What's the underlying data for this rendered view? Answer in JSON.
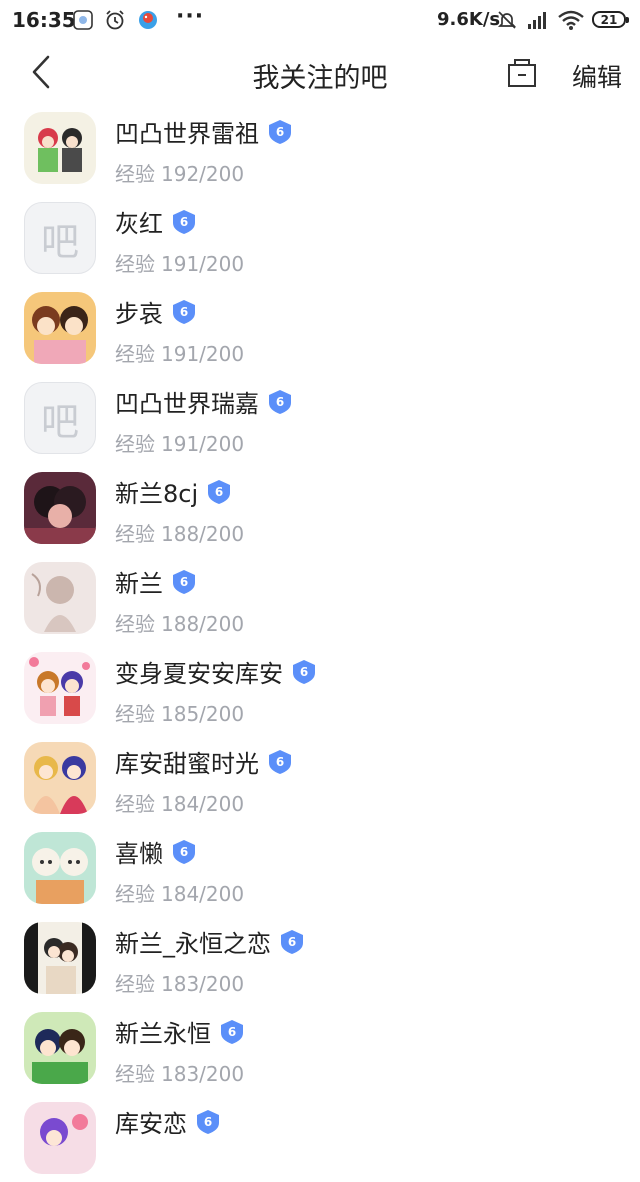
{
  "status_bar": {
    "time": "16:35",
    "network_speed": "9.6K/s",
    "battery": "21",
    "icons": [
      "notification-app-icon",
      "alarm-icon",
      "bird-app-icon",
      "more-dots-icon",
      "mute-bell-icon",
      "signal-icon",
      "wifi-icon",
      "battery-icon"
    ],
    "dots": "···"
  },
  "nav": {
    "title": "我关注的吧",
    "edit_label": "编辑",
    "back_icon": "chevron-left-icon",
    "folder_icon": "folder-icon"
  },
  "colors": {
    "level_badge": "#5b8ff9",
    "exp_text": "#a3a6ad"
  },
  "bars": [
    {
      "name": "凹凸世界雷祖",
      "level": "6",
      "exp_label": "经验",
      "exp": "192/200",
      "avatar": "cartoon-image"
    },
    {
      "name": "灰红",
      "level": "6",
      "exp_label": "经验",
      "exp": "191/200",
      "avatar": "placeholder",
      "placeholder_char": "吧"
    },
    {
      "name": "步哀",
      "level": "6",
      "exp_label": "经验",
      "exp": "191/200",
      "avatar": "cartoon-image"
    },
    {
      "name": "凹凸世界瑞嘉",
      "level": "6",
      "exp_label": "经验",
      "exp": "191/200",
      "avatar": "placeholder",
      "placeholder_char": "吧"
    },
    {
      "name": "新兰8cj",
      "level": "6",
      "exp_label": "经验",
      "exp": "188/200",
      "avatar": "cartoon-image"
    },
    {
      "name": "新兰",
      "level": "6",
      "exp_label": "经验",
      "exp": "188/200",
      "avatar": "cartoon-image"
    },
    {
      "name": "变身夏安安库安",
      "level": "6",
      "exp_label": "经验",
      "exp": "185/200",
      "avatar": "cartoon-image"
    },
    {
      "name": "库安甜蜜时光",
      "level": "6",
      "exp_label": "经验",
      "exp": "184/200",
      "avatar": "cartoon-image"
    },
    {
      "name": "喜懒",
      "level": "6",
      "exp_label": "经验",
      "exp": "184/200",
      "avatar": "cartoon-image"
    },
    {
      "name": "新兰_永恒之恋",
      "level": "6",
      "exp_label": "经验",
      "exp": "183/200",
      "avatar": "cartoon-image"
    },
    {
      "name": "新兰永恒",
      "level": "6",
      "exp_label": "经验",
      "exp": "183/200",
      "avatar": "cartoon-image"
    },
    {
      "name": "库安恋",
      "level": "6",
      "exp_label": "",
      "exp": "",
      "avatar": "cartoon-image"
    }
  ]
}
